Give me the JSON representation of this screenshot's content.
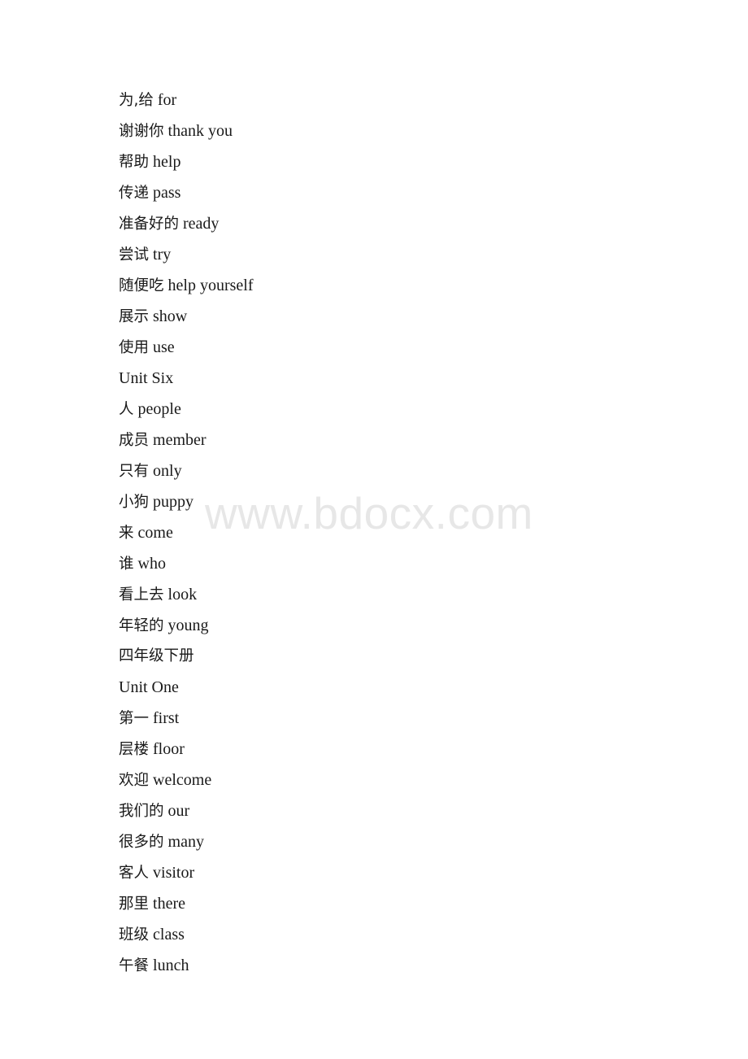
{
  "document": {
    "page_background": "#ffffff",
    "text_color": "#1a1a1a",
    "watermark": {
      "text": "www.bdocx.com",
      "color": "#e7e7e7"
    }
  },
  "entries": [
    {
      "cn": "为,给",
      "en": "for",
      "type": "pair"
    },
    {
      "cn": "谢谢你",
      "en": "thank you",
      "type": "pair"
    },
    {
      "cn": "帮助",
      "en": "help",
      "type": "pair"
    },
    {
      "cn": "传递",
      "en": "pass",
      "type": "pair"
    },
    {
      "cn": "准备好的",
      "en": "ready",
      "type": "pair"
    },
    {
      "cn": "尝试",
      "en": "try",
      "type": "pair"
    },
    {
      "cn": "随便吃",
      "en": "help yourself",
      "type": "pair"
    },
    {
      "cn": "展示",
      "en": "show",
      "type": "pair"
    },
    {
      "cn": "使用",
      "en": "use",
      "type": "pair"
    },
    {
      "cn": "",
      "en": "Unit Six",
      "type": "heading-en"
    },
    {
      "cn": "人",
      "en": "people",
      "type": "pair"
    },
    {
      "cn": "成员",
      "en": "member",
      "type": "pair"
    },
    {
      "cn": "只有",
      "en": "only",
      "type": "pair"
    },
    {
      "cn": "小狗",
      "en": "puppy",
      "type": "pair"
    },
    {
      "cn": "来",
      "en": "come",
      "type": "pair"
    },
    {
      "cn": "谁",
      "en": "who",
      "type": "pair"
    },
    {
      "cn": "看上去",
      "en": "look",
      "type": "pair"
    },
    {
      "cn": "年轻的",
      "en": "young",
      "type": "pair"
    },
    {
      "cn": "四年级下册",
      "en": "",
      "type": "heading-cn"
    },
    {
      "cn": "",
      "en": "Unit One",
      "type": "heading-en"
    },
    {
      "cn": "第一",
      "en": "first",
      "type": "pair"
    },
    {
      "cn": "层楼",
      "en": "floor",
      "type": "pair"
    },
    {
      "cn": "欢迎",
      "en": "welcome",
      "type": "pair"
    },
    {
      "cn": "我们的",
      "en": "our",
      "type": "pair"
    },
    {
      "cn": "很多的",
      "en": "many",
      "type": "pair"
    },
    {
      "cn": "客人",
      "en": "visitor",
      "type": "pair"
    },
    {
      "cn": "那里",
      "en": "there",
      "type": "pair"
    },
    {
      "cn": "班级",
      "en": "class",
      "type": "pair"
    },
    {
      "cn": "午餐",
      "en": "lunch",
      "type": "pair"
    }
  ]
}
